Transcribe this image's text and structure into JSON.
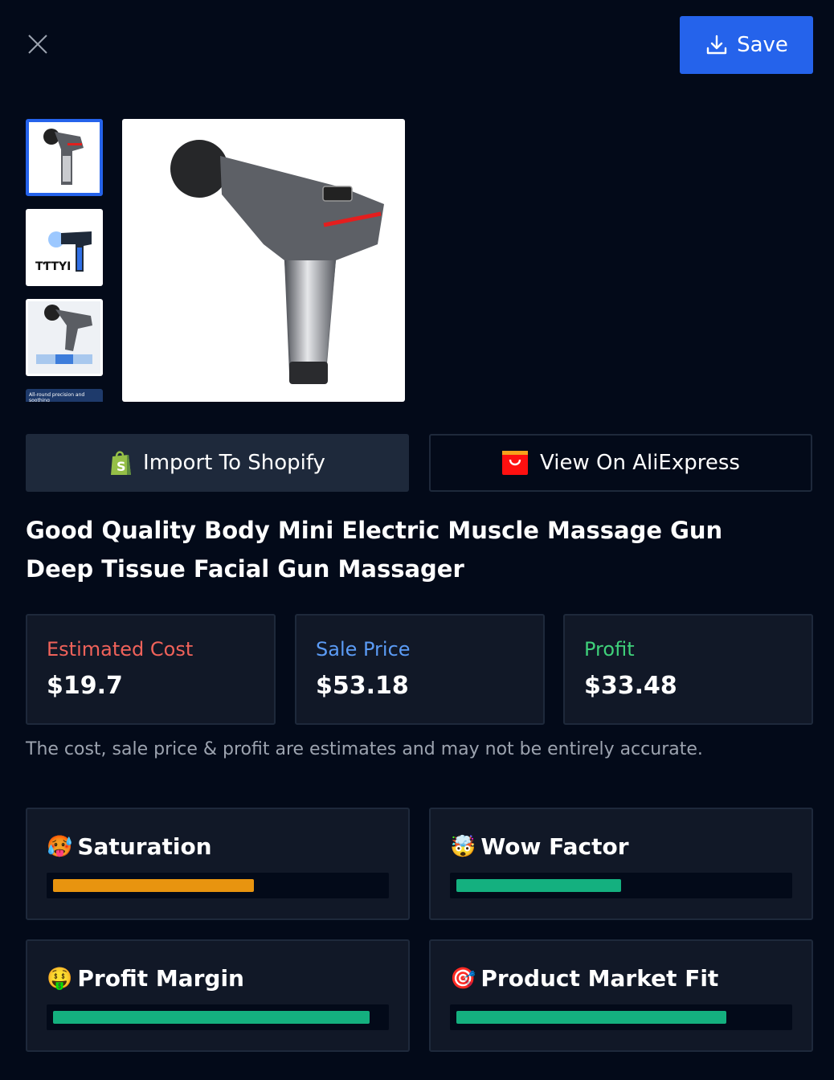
{
  "header": {
    "close_icon": "close-icon",
    "save_label": "Save",
    "save_icon": "download-icon"
  },
  "gallery": {
    "thumbnails": [
      {
        "label": "massage gun grey",
        "active": true
      },
      {
        "label": "massage gun blue with attachments",
        "active": false
      },
      {
        "label": "massage gun detail",
        "active": false
      },
      {
        "label": "All-round precision and soothing",
        "active": false
      }
    ],
    "partial_thumb_text": "All-round precision and soothing"
  },
  "actions": {
    "shopify_label": "Import To Shopify",
    "shopify_icon": "shopify-bag-icon",
    "ali_label": "View On AliExpress",
    "ali_icon": "aliexpress-icon"
  },
  "product": {
    "title": "Good Quality Body Mini Electric Muscle Massage Gun Deep Tissue Facial Gun Massager"
  },
  "stats": [
    {
      "label": "Estimated Cost",
      "value": "$19.7",
      "color": "#f0625a"
    },
    {
      "label": "Sale Price",
      "value": "$53.18",
      "color": "#5b9bf5"
    },
    {
      "label": "Profit",
      "value": "$33.48",
      "color": "#3fd07a"
    }
  ],
  "disclaimer": "The cost, sale price & profit are estimates and may not be entirely accurate.",
  "metrics": [
    {
      "label": "Saturation",
      "emoji": "🥵",
      "icon": "hot-face-icon",
      "percent": 61,
      "color": "orange"
    },
    {
      "label": "Wow Factor",
      "emoji": "🤯",
      "icon": "exploding-head-icon",
      "percent": 50,
      "color": "green"
    },
    {
      "label": "Profit Margin",
      "emoji": "🤑",
      "icon": "money-face-icon",
      "percent": 96,
      "color": "green"
    },
    {
      "label": "Product Market Fit",
      "emoji": "🎯",
      "icon": "target-icon",
      "percent": 82,
      "color": "green"
    }
  ]
}
